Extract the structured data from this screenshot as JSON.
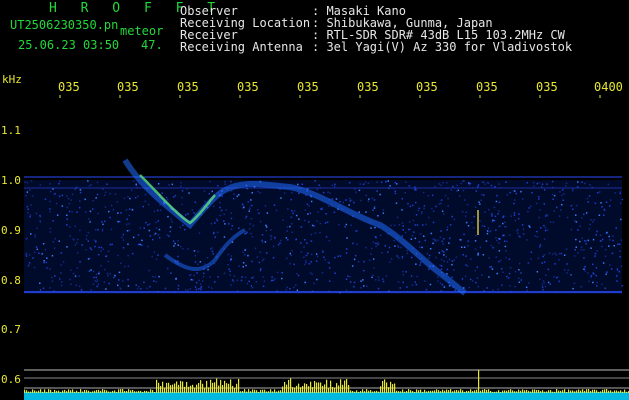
{
  "header": {
    "title": "H R O F F T",
    "filename": "UT2506230350.pn",
    "meteor": "meteor",
    "timestamp": "25.06.23 03:50",
    "count": "47."
  },
  "info": [
    {
      "label": "Observer",
      "value": ": Masaki Kano"
    },
    {
      "label": "Receiving Location",
      "value": ": Shibukawa, Gunma, Japan"
    },
    {
      "label": "Receiver",
      "value": ": RTL-SDR SDR# 43dB L15 103.2MHz CW"
    },
    {
      "label": "Receiving Antenna",
      "value": ": 3el Yagi(V) Az 330 for Vladivostok"
    }
  ],
  "axis": {
    "unit": "kHz",
    "time_ticks": [
      "035",
      "035",
      "035",
      "035",
      "035",
      "035",
      "035",
      "035",
      "035",
      "0400"
    ],
    "freq_labels": [
      "1.1",
      "1.0",
      "0.9",
      "0.8",
      "0.7",
      "0.6"
    ]
  },
  "colors": {
    "label_yellow": "#e8e830",
    "title_green": "#22d83a"
  }
}
